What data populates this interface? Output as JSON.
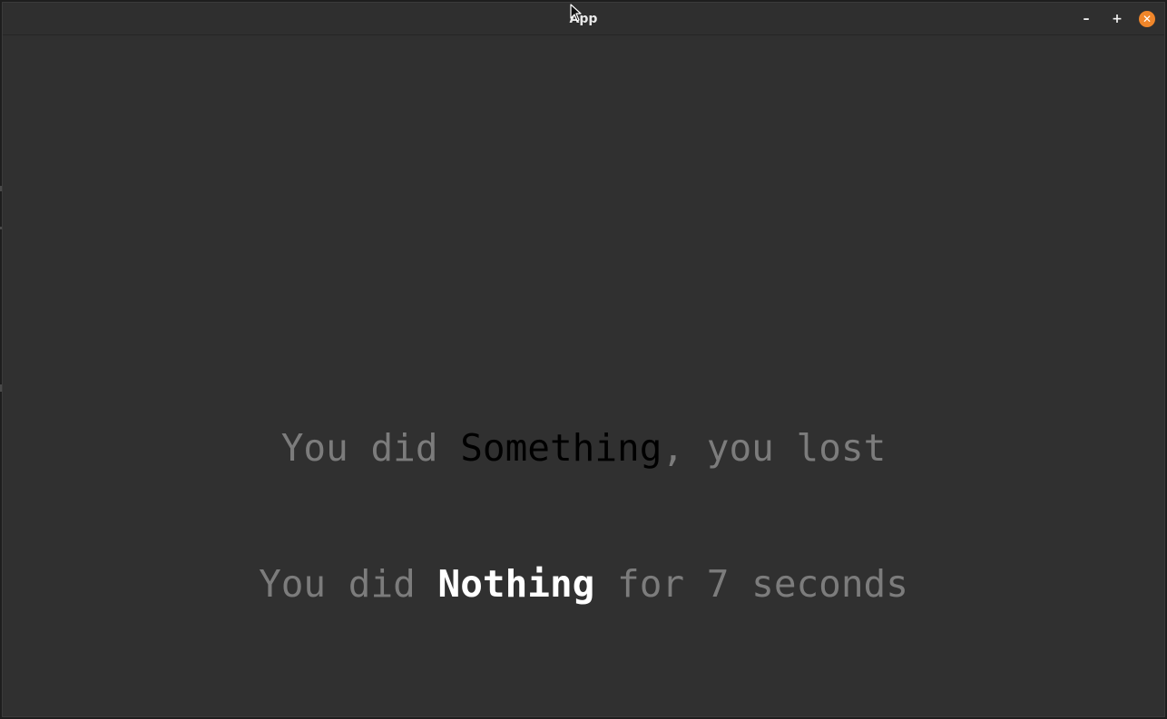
{
  "window": {
    "title": "App",
    "controls": {
      "minimize": "–",
      "maximize": "+",
      "close": "✕"
    }
  },
  "message": {
    "line1": {
      "prefix": "You did ",
      "highlight": "Something",
      "suffix": ", you lost"
    },
    "line2": {
      "prefix": "You did ",
      "highlight": "Nothing",
      "suffix": " for 7 seconds"
    }
  },
  "colors": {
    "background": "#303030",
    "dim_text": "#7c7c7c",
    "dark_highlight": "#000000",
    "bright_highlight": "#ffffff",
    "close_button": "#f0862a"
  },
  "icons": {
    "cursor": "mouse-pointer-icon",
    "minimize": "minimize-icon",
    "maximize": "maximize-icon",
    "close": "close-icon"
  }
}
